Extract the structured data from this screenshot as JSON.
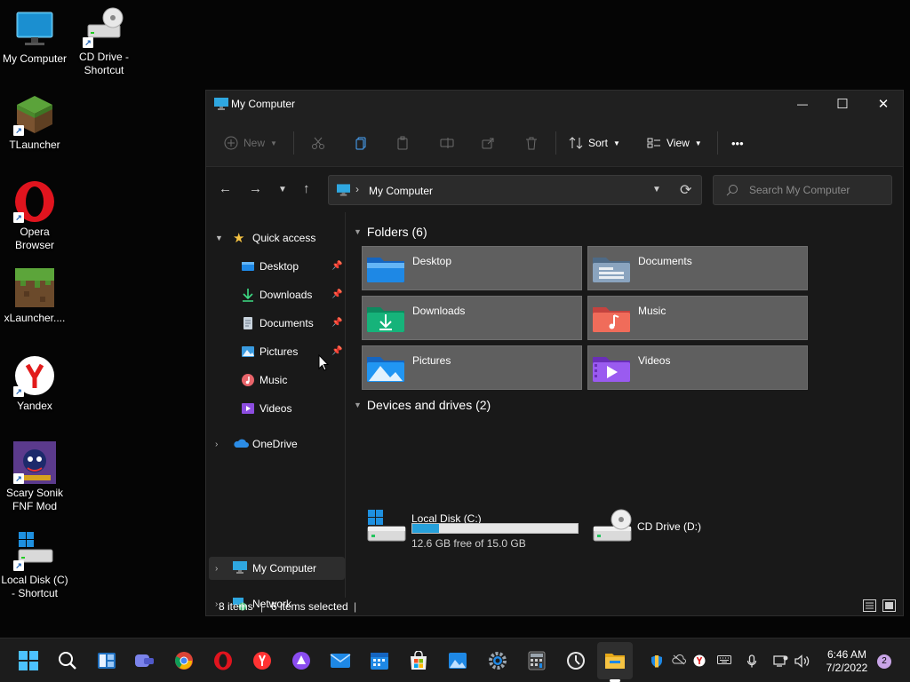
{
  "desktop": {
    "icons": [
      {
        "label": "My Computer",
        "icon": "monitor-icon"
      },
      {
        "label": "CD Drive - Shortcut",
        "icon": "cd-drive-icon"
      },
      {
        "label": "TLauncher",
        "icon": "minecraft-grass-block-icon"
      },
      {
        "label": "Opera Browser",
        "icon": "opera-icon"
      },
      {
        "label": "xLauncher....",
        "icon": "minecraft-block-icon"
      },
      {
        "label": "Yandex",
        "icon": "yandex-icon"
      },
      {
        "label": "Scary Sonik FNF Mod",
        "icon": "game-icon"
      },
      {
        "label": "Local Disk (C) - Shortcut",
        "icon": "local-disk-icon"
      }
    ]
  },
  "window": {
    "title": "My Computer",
    "controls": {
      "minimize": "—",
      "maximize": "☐",
      "close": "✕"
    },
    "toolbar": {
      "new_label": "New",
      "sort_label": "Sort",
      "view_label": "View",
      "more_label": "•••"
    },
    "address": {
      "path": "My Computer",
      "search_placeholder": "Search My Computer"
    },
    "sidebar": {
      "quick_access": "Quick access",
      "items": [
        {
          "label": "Desktop",
          "pinned": true
        },
        {
          "label": "Downloads",
          "pinned": true
        },
        {
          "label": "Documents",
          "pinned": true
        },
        {
          "label": "Pictures",
          "pinned": true
        },
        {
          "label": "Music",
          "pinned": false
        },
        {
          "label": "Videos",
          "pinned": false
        }
      ],
      "onedrive": "OneDrive",
      "my_computer": "My Computer",
      "network": "Network"
    },
    "content": {
      "folders_header": "Folders (6)",
      "folders": [
        "Desktop",
        "Documents",
        "Downloads",
        "Music",
        "Pictures",
        "Videos"
      ],
      "devices_header": "Devices and drives (2)",
      "drives": [
        {
          "name": "Local Disk (C:)",
          "free_text": "12.6 GB free of 15.0 GB",
          "used_fraction": 0.16
        },
        {
          "name": "CD Drive (D:)"
        }
      ]
    },
    "status": {
      "items_count": "8 items",
      "selected": "6 items selected"
    }
  },
  "taskbar": {
    "apps": [
      "start",
      "search",
      "widgets",
      "chat",
      "chrome",
      "opera",
      "yandex",
      "alice",
      "mail",
      "calendar",
      "store",
      "photos",
      "settings",
      "calculator",
      "clock",
      "file-explorer"
    ],
    "clock_time": "6:46 AM",
    "clock_date": "7/2/2022",
    "notifications": "2"
  },
  "colors": {
    "accent": "#26a0da",
    "folder_yellow": "#f6c342",
    "window_bg": "#191919",
    "selected_tile": "#5f5f5f"
  }
}
